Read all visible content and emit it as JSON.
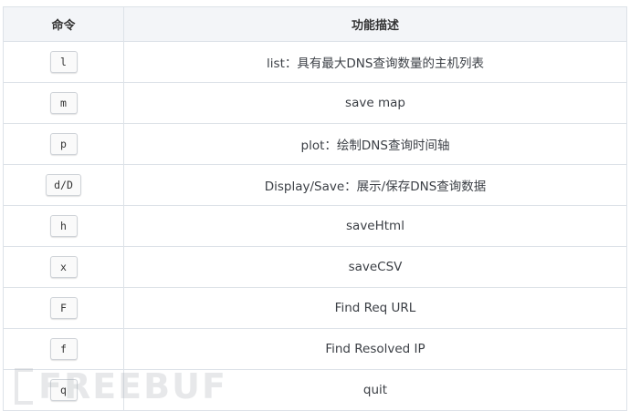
{
  "table": {
    "headers": {
      "command": "命令",
      "description": "功能描述"
    },
    "rows": [
      {
        "key": "l",
        "desc": "list：具有最大DNS查询数量的主机列表"
      },
      {
        "key": "m",
        "desc": "save map"
      },
      {
        "key": "p",
        "desc": "plot：绘制DNS查询时间轴"
      },
      {
        "key": "d/D",
        "desc": "Display/Save：展示/保存DNS查询数据"
      },
      {
        "key": "h",
        "desc": "saveHtml"
      },
      {
        "key": "x",
        "desc": "saveCSV"
      },
      {
        "key": "F",
        "desc": "Find Req URL"
      },
      {
        "key": "f",
        "desc": "Find Resolved IP"
      },
      {
        "key": "q",
        "desc": "quit"
      }
    ]
  },
  "watermark": {
    "text": "FREEBUF"
  }
}
